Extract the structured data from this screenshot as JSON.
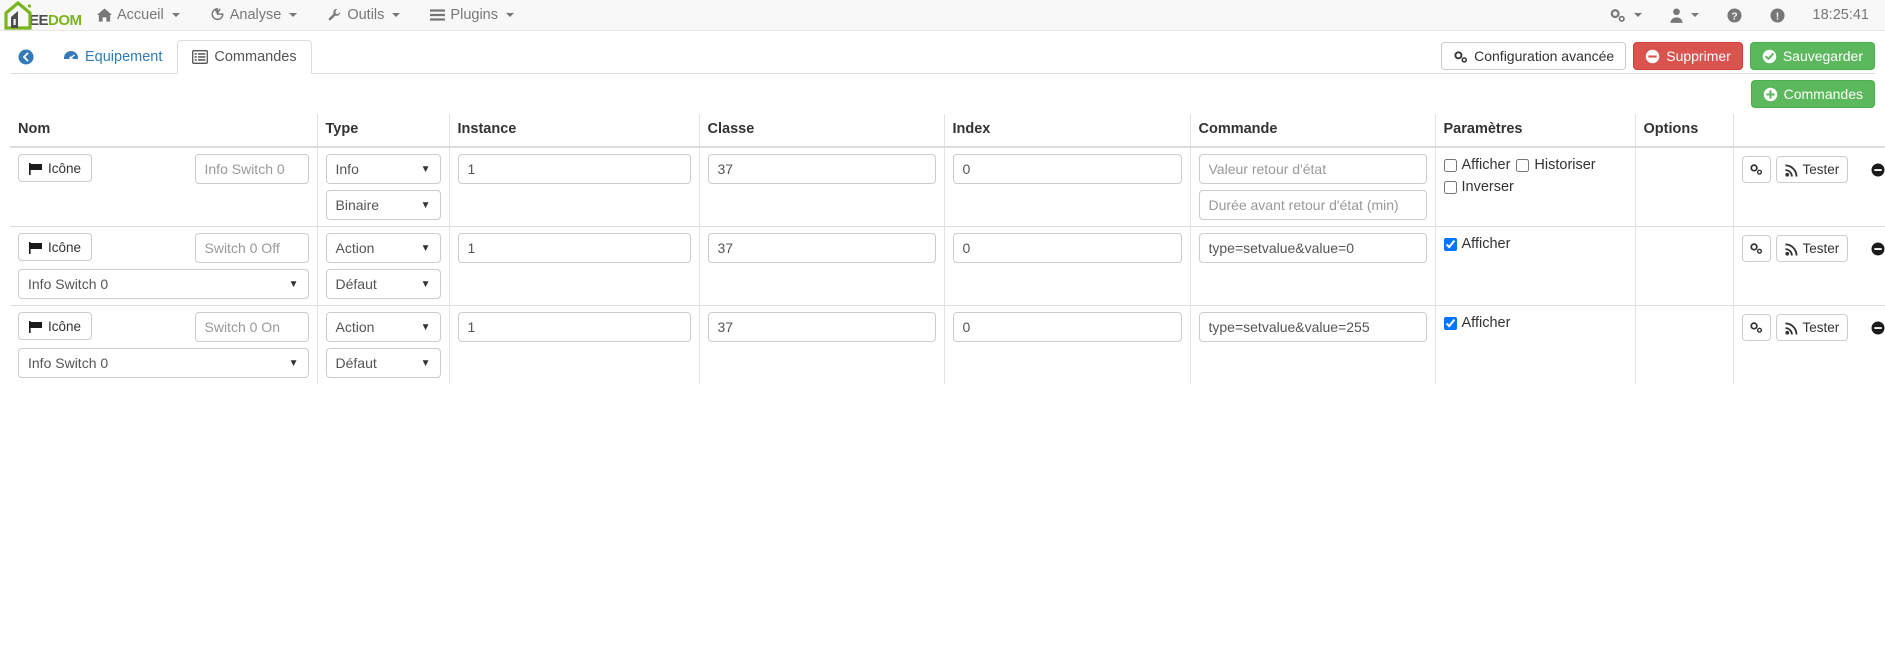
{
  "navbar": {
    "brand": {
      "text_dark": "EE",
      "text_green": "DOM",
      "green": "#7ab51d"
    },
    "menu": [
      {
        "label": "Accueil",
        "icon": "home-icon",
        "caret": true
      },
      {
        "label": "Analyse",
        "icon": "chart-icon",
        "caret": true
      },
      {
        "label": "Outils",
        "icon": "wrench-icon",
        "caret": true
      },
      {
        "label": "Plugins",
        "icon": "list-icon",
        "caret": true
      }
    ],
    "right": {
      "gear_icon": "cogs-icon",
      "user_icon": "user-icon",
      "help_icon": "question-circle-icon",
      "info_icon": "exclamation-circle-icon",
      "clock": "18:25:41"
    }
  },
  "tabs": {
    "back_icon": "arrow-circle-left-icon",
    "items": [
      {
        "label": "Equipement",
        "icon": "dashboard-icon",
        "active": false
      },
      {
        "label": "Commandes",
        "icon": "list-alt-icon",
        "active": true
      }
    ],
    "buttons": [
      {
        "label": "Configuration avancée",
        "icon": "cogs-icon",
        "style": "default"
      },
      {
        "label": "Supprimer",
        "icon": "minus-circle-icon",
        "style": "danger"
      },
      {
        "label": "Sauvegarder",
        "icon": "check-circle-icon",
        "style": "success"
      }
    ],
    "add_button": {
      "label": "Commandes",
      "icon": "plus-circle-icon",
      "style": "success"
    }
  },
  "table": {
    "headers": [
      "Nom",
      "Type",
      "Instance",
      "Classe",
      "Index",
      "Commande",
      "Paramètres",
      "Options",
      ""
    ],
    "icon_button_label": "Icône",
    "tester_label": "Tester",
    "rows": [
      {
        "icon_label": "Icône",
        "name_value": "Info Switch 0",
        "name_value_is_placeholder": true,
        "linked_select": null,
        "type_select": "Info",
        "subtype_select": "Binaire",
        "instance": "1",
        "classe": "37",
        "index": "0",
        "commande_fields": [
          {
            "placeholder": "Valeur retour d'état",
            "value": ""
          },
          {
            "placeholder": "Durée avant retour d'état (min)",
            "value": ""
          }
        ],
        "params": [
          {
            "label": "Afficher",
            "checked": false
          },
          {
            "label": "Historiser",
            "checked": false
          },
          {
            "label": "Inverser",
            "checked": false
          }
        ],
        "options": ""
      },
      {
        "icon_label": "Icône",
        "name_value": "Switch 0 Off",
        "name_value_is_placeholder": true,
        "linked_select": "Info Switch 0",
        "type_select": "Action",
        "subtype_select": "Défaut",
        "instance": "1",
        "classe": "37",
        "index": "0",
        "commande_fields": [
          {
            "placeholder": "",
            "value": "type=setvalue&value=0"
          }
        ],
        "params": [
          {
            "label": "Afficher",
            "checked": true
          }
        ],
        "options": ""
      },
      {
        "icon_label": "Icône",
        "name_value": "Switch 0 On",
        "name_value_is_placeholder": true,
        "linked_select": "Info Switch 0",
        "type_select": "Action",
        "subtype_select": "Défaut",
        "instance": "1",
        "classe": "37",
        "index": "0",
        "commande_fields": [
          {
            "placeholder": "",
            "value": "type=setvalue&value=255"
          }
        ],
        "params": [
          {
            "label": "Afficher",
            "checked": true
          }
        ],
        "options": ""
      }
    ]
  }
}
